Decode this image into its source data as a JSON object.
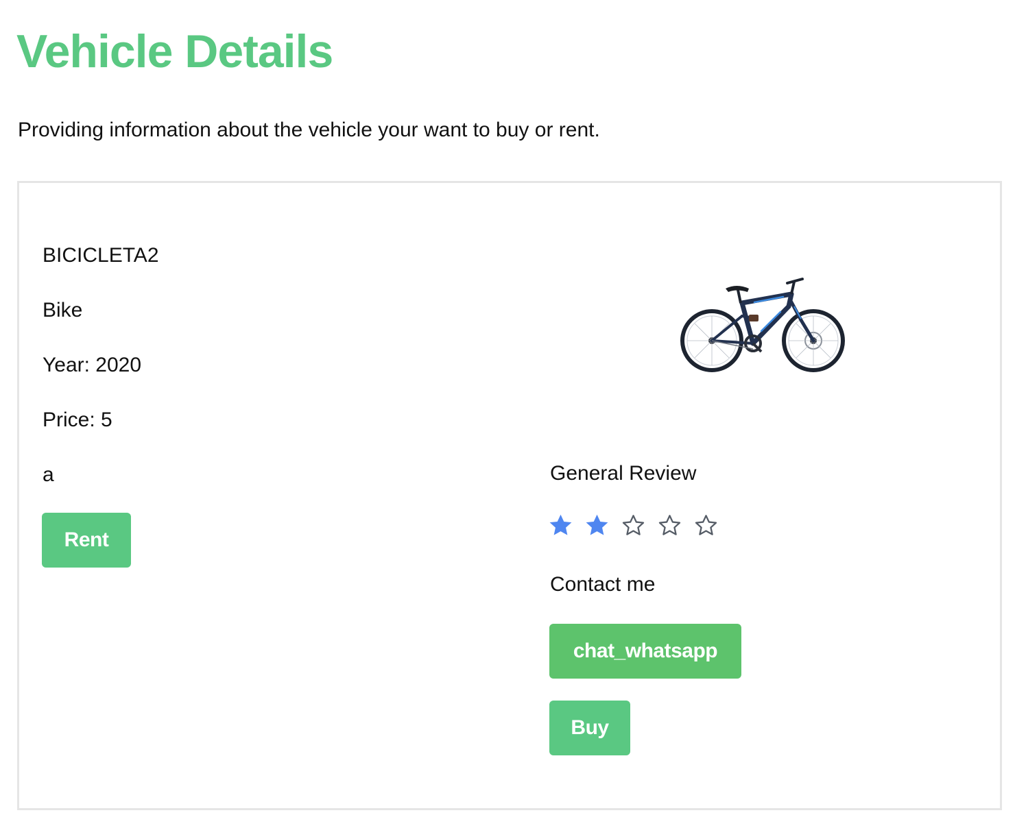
{
  "header": {
    "title": "Vehicle Details",
    "subtitle": "Providing information about the vehicle your want to buy or rent."
  },
  "vehicle": {
    "name": "BICICLETA2",
    "type": "Bike",
    "year": "Year: 2020",
    "price": "Price: 5",
    "description": "a",
    "image_icon": "bicycle-image"
  },
  "actions": {
    "rent_label": "Rent",
    "whatsapp_label": "chat_whatsapp",
    "buy_label": "Buy"
  },
  "review": {
    "title": "General Review",
    "rating": 2,
    "max_rating": 5
  },
  "contact": {
    "title": "Contact me"
  },
  "colors": {
    "title_green": "#5ac882",
    "rent_button": "#5ac882",
    "whatsapp_button": "#5dc36c",
    "buy_button": "#5ac882",
    "star_filled": "#4f86f0",
    "star_outline": "#555c66",
    "card_border": "#e5e5e5"
  }
}
